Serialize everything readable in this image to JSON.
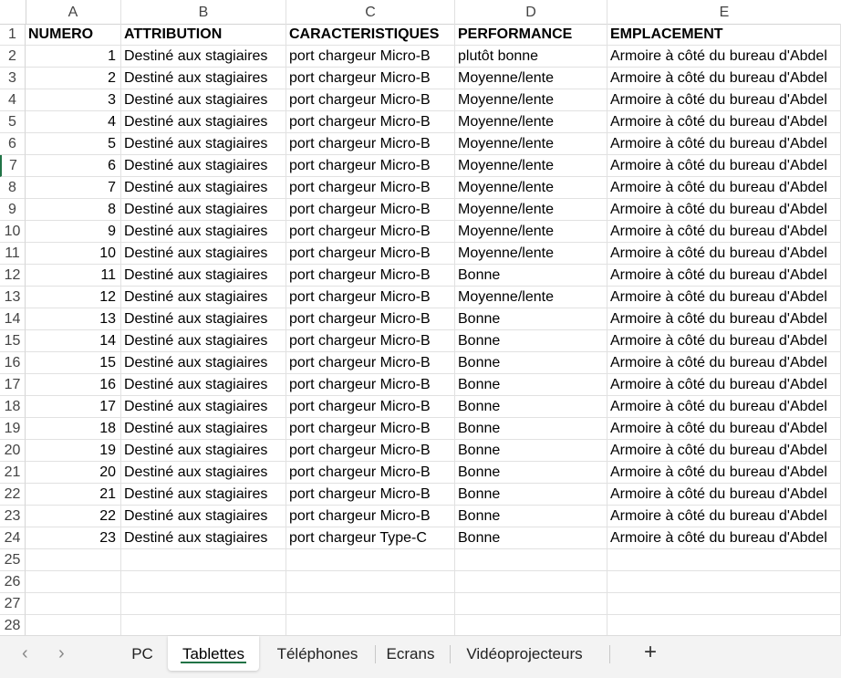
{
  "columns": [
    "A",
    "B",
    "C",
    "D",
    "E"
  ],
  "header_row": [
    "NUMERO",
    "ATTRIBUTION",
    "CARACTERISTIQUES",
    "PERFORMANCE",
    "EMPLACEMENT"
  ],
  "rows": [
    [
      "1",
      "Destiné aux stagiaires",
      "port chargeur Micro-B",
      "plutôt bonne",
      "Armoire à côté du bureau d'Abdel"
    ],
    [
      "2",
      "Destiné aux stagiaires",
      "port chargeur Micro-B",
      "Moyenne/lente",
      "Armoire à côté du bureau d'Abdel"
    ],
    [
      "3",
      "Destiné aux stagiaires",
      "port chargeur Micro-B",
      "Moyenne/lente",
      "Armoire à côté du bureau d'Abdel"
    ],
    [
      "4",
      "Destiné aux stagiaires",
      "port chargeur Micro-B",
      "Moyenne/lente",
      "Armoire à côté du bureau d'Abdel"
    ],
    [
      "5",
      "Destiné aux stagiaires",
      "port chargeur Micro-B",
      "Moyenne/lente",
      "Armoire à côté du bureau d'Abdel"
    ],
    [
      "6",
      "Destiné aux stagiaires",
      "port chargeur Micro-B",
      "Moyenne/lente",
      "Armoire à côté du bureau d'Abdel"
    ],
    [
      "7",
      "Destiné aux stagiaires",
      "port chargeur Micro-B",
      "Moyenne/lente",
      "Armoire à côté du bureau d'Abdel"
    ],
    [
      "8",
      "Destiné aux stagiaires",
      "port chargeur Micro-B",
      "Moyenne/lente",
      "Armoire à côté du bureau d'Abdel"
    ],
    [
      "9",
      "Destiné aux stagiaires",
      "port chargeur Micro-B",
      "Moyenne/lente",
      "Armoire à côté du bureau d'Abdel"
    ],
    [
      "10",
      "Destiné aux stagiaires",
      "port chargeur Micro-B",
      "Moyenne/lente",
      "Armoire à côté du bureau d'Abdel"
    ],
    [
      "11",
      "Destiné aux stagiaires",
      "port chargeur Micro-B",
      "Bonne",
      "Armoire à côté du bureau d'Abdel"
    ],
    [
      "12",
      "Destiné aux stagiaires",
      "port chargeur Micro-B",
      "Moyenne/lente",
      "Armoire à côté du bureau d'Abdel"
    ],
    [
      "13",
      "Destiné aux stagiaires",
      "port chargeur Micro-B",
      "Bonne",
      "Armoire à côté du bureau d'Abdel"
    ],
    [
      "14",
      "Destiné aux stagiaires",
      "port chargeur Micro-B",
      "Bonne",
      "Armoire à côté du bureau d'Abdel"
    ],
    [
      "15",
      "Destiné aux stagiaires",
      "port chargeur Micro-B",
      "Bonne",
      "Armoire à côté du bureau d'Abdel"
    ],
    [
      "16",
      "Destiné aux stagiaires",
      "port chargeur Micro-B",
      "Bonne",
      "Armoire à côté du bureau d'Abdel"
    ],
    [
      "17",
      "Destiné aux stagiaires",
      "port chargeur Micro-B",
      "Bonne",
      "Armoire à côté du bureau d'Abdel"
    ],
    [
      "18",
      "Destiné aux stagiaires",
      "port chargeur Micro-B",
      "Bonne",
      "Armoire à côté du bureau d'Abdel"
    ],
    [
      "19",
      "Destiné aux stagiaires",
      "port chargeur Micro-B",
      "Bonne",
      "Armoire à côté du bureau d'Abdel"
    ],
    [
      "20",
      "Destiné aux stagiaires",
      "port chargeur Micro-B",
      "Bonne",
      "Armoire à côté du bureau d'Abdel"
    ],
    [
      "21",
      "Destiné aux stagiaires",
      "port chargeur Micro-B",
      "Bonne",
      "Armoire à côté du bureau d'Abdel"
    ],
    [
      "22",
      "Destiné aux stagiaires",
      "port chargeur Micro-B",
      "Bonne",
      "Armoire à côté du bureau d'Abdel"
    ],
    [
      "23",
      "Destiné aux stagiaires",
      "port chargeur Type-C",
      "Bonne",
      "Armoire à côté du bureau d'Abdel"
    ]
  ],
  "row_numbers": [
    "1",
    "2",
    "3",
    "4",
    "5",
    "6",
    "7",
    "8",
    "9",
    "10",
    "11",
    "12",
    "13",
    "14",
    "15",
    "16",
    "17",
    "18",
    "19",
    "20",
    "21",
    "22",
    "23",
    "24",
    "25",
    "26",
    "27",
    "28"
  ],
  "selected_row": "7",
  "sheet_tabs": {
    "prev_icon": "‹",
    "next_icon": "›",
    "tabs": [
      "PC",
      "Tablettes",
      "Téléphones",
      "Ecrans",
      "Vidéoprojecteurs"
    ],
    "active": "Tablettes",
    "add_label": "+"
  },
  "colors": {
    "accent": "#217346",
    "gridline": "#e1e1e1",
    "tabbar_bg": "#f3f3f3"
  }
}
